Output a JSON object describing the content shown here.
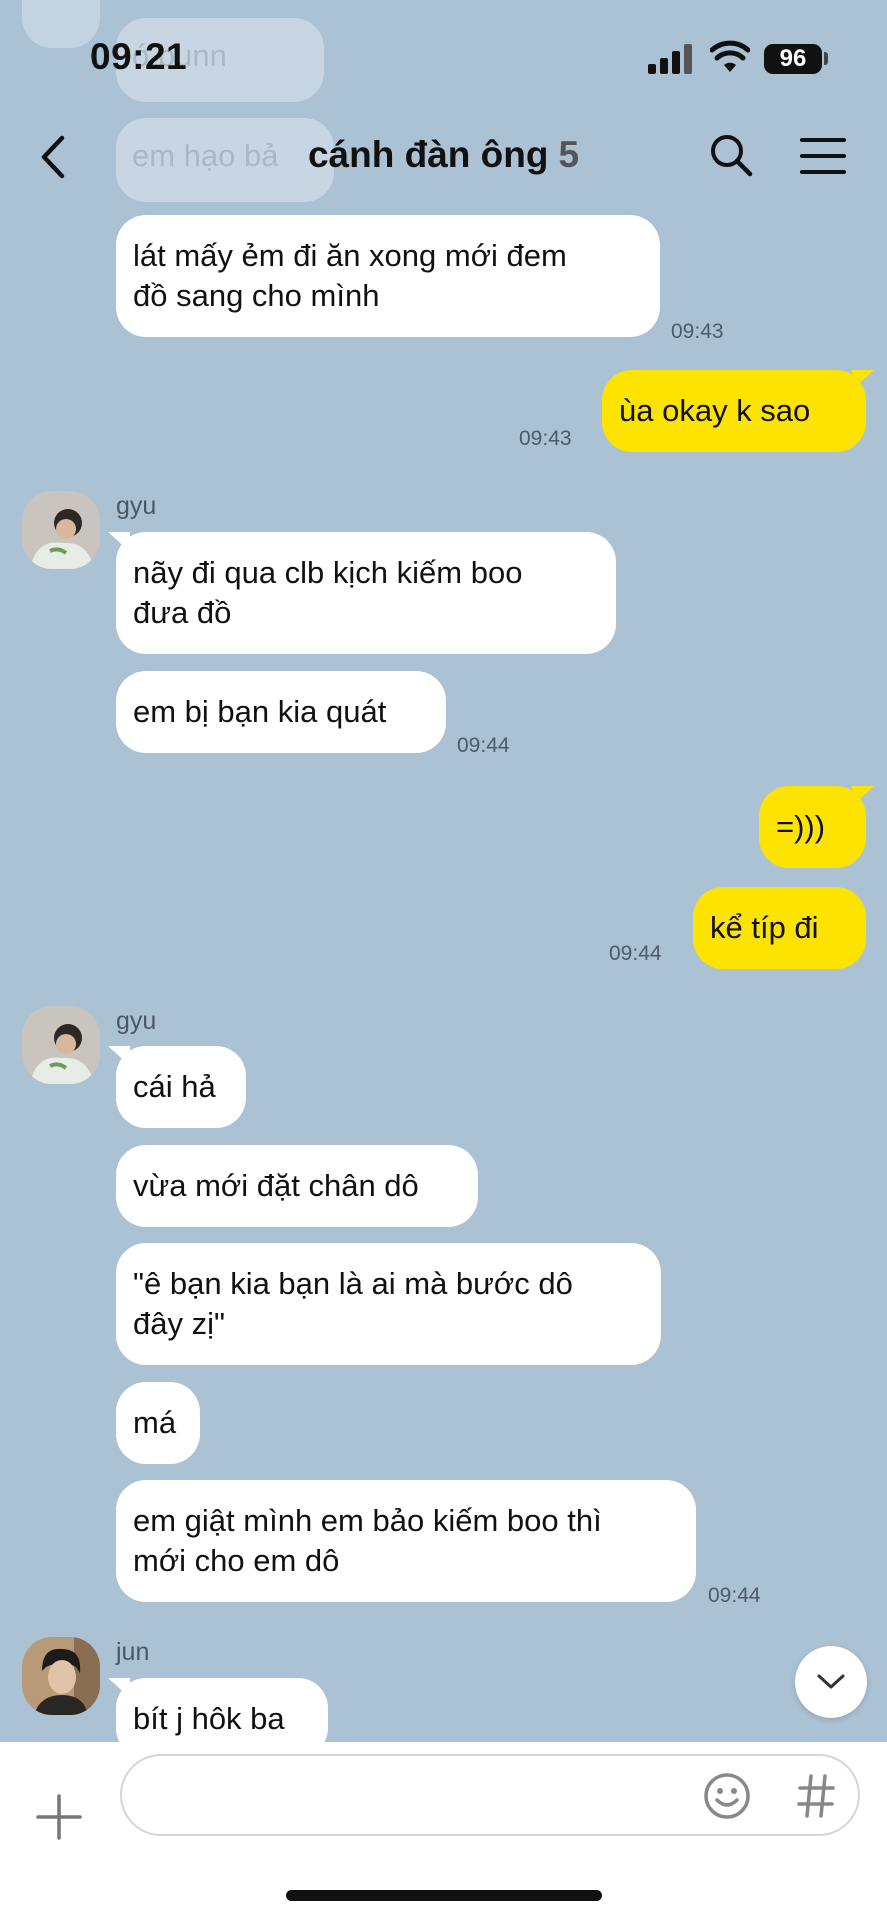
{
  "status_bar": {
    "time": "09:21",
    "battery": "96"
  },
  "faded_above": [
    "ó bunn",
    "em hạo bả"
  ],
  "header": {
    "title": "cánh đàn ông",
    "member_count": "5"
  },
  "messages": [
    {
      "side": "in",
      "text": "lát mấy ẻm đi ăn xong mới đem\nđồ sang cho mình",
      "time": "09:43"
    },
    {
      "side": "out",
      "text": "ùa okay k sao",
      "time": "09:43"
    },
    {
      "side": "in",
      "sender": "gyu",
      "text": "nãy đi qua clb kịch kiếm boo\nđưa đồ"
    },
    {
      "side": "in",
      "text": "em bị bạn kia quát",
      "time": "09:44"
    },
    {
      "side": "out",
      "text": "=)))"
    },
    {
      "side": "out",
      "text": "kể típ đi",
      "time": "09:44"
    },
    {
      "side": "in",
      "sender": "gyu",
      "text": "cái hả"
    },
    {
      "side": "in",
      "text": "vừa mới đặt chân dô"
    },
    {
      "side": "in",
      "text": "\"ê bạn kia bạn là ai mà bước dô\nđây zị\""
    },
    {
      "side": "in",
      "text": "má"
    },
    {
      "side": "in",
      "text": "em giật mình em bảo kiếm boo thì\nmới cho em dô",
      "time": "09:44"
    },
    {
      "side": "in",
      "sender": "jun",
      "text": "bít j hôk ba"
    }
  ],
  "composer": {
    "placeholder": ""
  },
  "colors": {
    "background": "#abc1d4",
    "outgoing_bubble": "#fce300",
    "incoming_bubble": "#ffffff"
  },
  "icons": [
    "back-icon",
    "search-icon",
    "menu-icon",
    "plus-icon",
    "emoji-icon",
    "hash-icon",
    "chevron-down-icon"
  ]
}
